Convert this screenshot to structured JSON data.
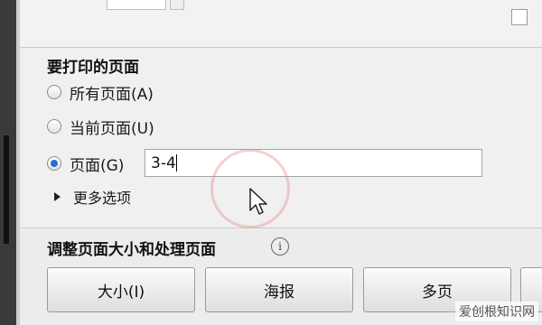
{
  "pages_section": {
    "title": "要打印的页面",
    "options": [
      {
        "label": "所有页面(A)",
        "checked": false
      },
      {
        "label": "当前页面(U)",
        "checked": false
      },
      {
        "label": "页面(G)",
        "checked": true
      }
    ],
    "pages_value": "3-4",
    "more_options": "更多选项"
  },
  "resize_section": {
    "title": "调整页面大小和处理页面",
    "info_glyph": "i",
    "buttons": [
      {
        "label": "大小(I)"
      },
      {
        "label": "海报"
      },
      {
        "label": "多页"
      },
      {
        "label": ""
      }
    ]
  },
  "watermark": "爱创根知识网",
  "colors": {
    "accent": "#2b6ed1",
    "ripple": "#e67878"
  }
}
